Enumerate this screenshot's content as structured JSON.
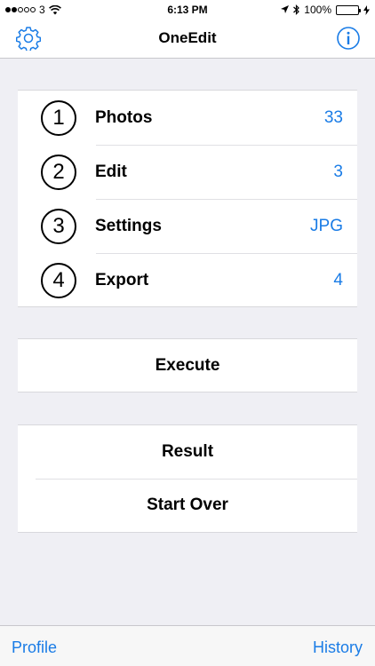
{
  "status_bar": {
    "carrier": "3",
    "time": "6:13 PM",
    "battery": "100%",
    "icons": [
      "signal-dots-icon",
      "wifi-icon",
      "location-icon",
      "bluetooth-icon",
      "battery-icon",
      "charging-icon"
    ]
  },
  "nav": {
    "title": "OneEdit",
    "left_icon": "gear-icon",
    "right_icon": "info-icon",
    "accent_color": "#1a7ce6"
  },
  "steps": [
    {
      "number": "1",
      "label": "Photos",
      "value": "33"
    },
    {
      "number": "2",
      "label": "Edit",
      "value": "3"
    },
    {
      "number": "3",
      "label": "Settings",
      "value": "JPG"
    },
    {
      "number": "4",
      "label": "Export",
      "value": "4"
    }
  ],
  "execute": {
    "label": "Execute"
  },
  "result_group": {
    "result_label": "Result",
    "start_over_label": "Start Over"
  },
  "bottom_bar": {
    "left_label": "Profile",
    "right_label": "History"
  }
}
